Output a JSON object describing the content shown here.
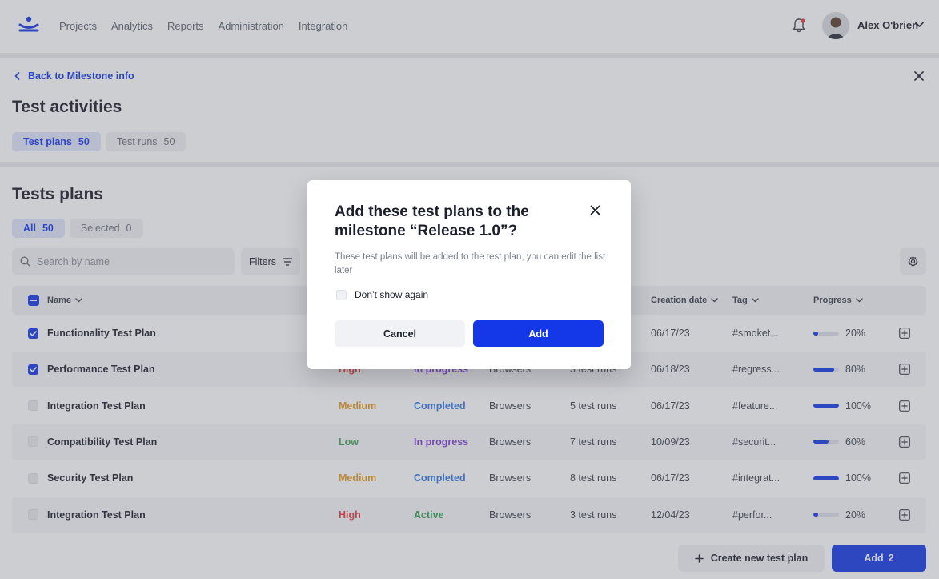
{
  "nav": {
    "items": [
      {
        "label": "Projects",
        "active": true
      },
      {
        "label": "Analytics",
        "active": false
      },
      {
        "label": "Reports",
        "active": false
      },
      {
        "label": "Administration",
        "active": false
      },
      {
        "label": "Integration",
        "active": false
      }
    ]
  },
  "user": {
    "name": "Alex O'brien",
    "notification_icon": "bell-icon",
    "has_unread": true
  },
  "header": {
    "back_label": "Back to Milestone info",
    "title": "Test activities",
    "tabs": [
      {
        "label": "Test plans",
        "count": "50",
        "active": true
      },
      {
        "label": "Test runs",
        "count": "50",
        "active": false
      }
    ]
  },
  "plans": {
    "title": "Tests plans",
    "filters": [
      {
        "label": "All",
        "count": "50",
        "active": true
      },
      {
        "label": "Selected",
        "count": "0",
        "active": false
      }
    ],
    "search_placeholder": "Search by name",
    "filters_label": "Filters",
    "columns": {
      "name": "Name",
      "creation_date": "Creation date",
      "tag": "Tag",
      "progress": "Progress"
    },
    "rows": [
      {
        "name": "Functionality Test Plan",
        "checked": true,
        "priority": "",
        "status": "",
        "env": "",
        "runs": "",
        "date": "06/17/23",
        "tag": "#smoket...",
        "progress": 20,
        "progress_label": "20%"
      },
      {
        "name": "Performance Test Plan",
        "checked": true,
        "priority": "High",
        "status": "In progress",
        "env": "Browsers",
        "runs": "3 test runs",
        "date": "06/18/23",
        "tag": "#regress...",
        "progress": 80,
        "progress_label": "80%"
      },
      {
        "name": "Integration Test Plan",
        "checked": false,
        "priority": "Medium",
        "status": "Completed",
        "env": "Browsers",
        "runs": "5 test runs",
        "date": "06/17/23",
        "tag": "#feature...",
        "progress": 100,
        "progress_label": "100%"
      },
      {
        "name": "Compatibility Test Plan",
        "checked": false,
        "priority": "Low",
        "status": "In progress",
        "env": "Browsers",
        "runs": "7 test runs",
        "date": "10/09/23",
        "tag": "#securit...",
        "progress": 60,
        "progress_label": "60%"
      },
      {
        "name": "Security Test Plan",
        "checked": false,
        "priority": "Medium",
        "status": "Completed",
        "env": "Browsers",
        "runs": "8 test runs",
        "date": "06/17/23",
        "tag": "#integrat...",
        "progress": 100,
        "progress_label": "100%"
      },
      {
        "name": "Integration Test Plan",
        "checked": false,
        "priority": "High",
        "status": "Active",
        "env": "Browsers",
        "runs": "3 test runs",
        "date": "12/04/23",
        "tag": "#perfor...",
        "progress": 20,
        "progress_label": "20%"
      }
    ]
  },
  "footer": {
    "create_label": "Create new test plan",
    "add_label": "Add",
    "add_count": "2"
  },
  "modal": {
    "title": "Add these test plans to the milestone “Release 1.0”?",
    "description": "These test plans will be added to the test plan, you can edit the list later",
    "checkbox_label": "Don’t show again",
    "cancel_label": "Cancel",
    "confirm_label": "Add"
  },
  "colors": {
    "accent": "#1438e8",
    "high": "#e0393e",
    "medium": "#e79a1a",
    "low": "#3aa657",
    "in_progress": "#7b3fd0",
    "completed": "#2e79e6",
    "active": "#2c9d52"
  }
}
